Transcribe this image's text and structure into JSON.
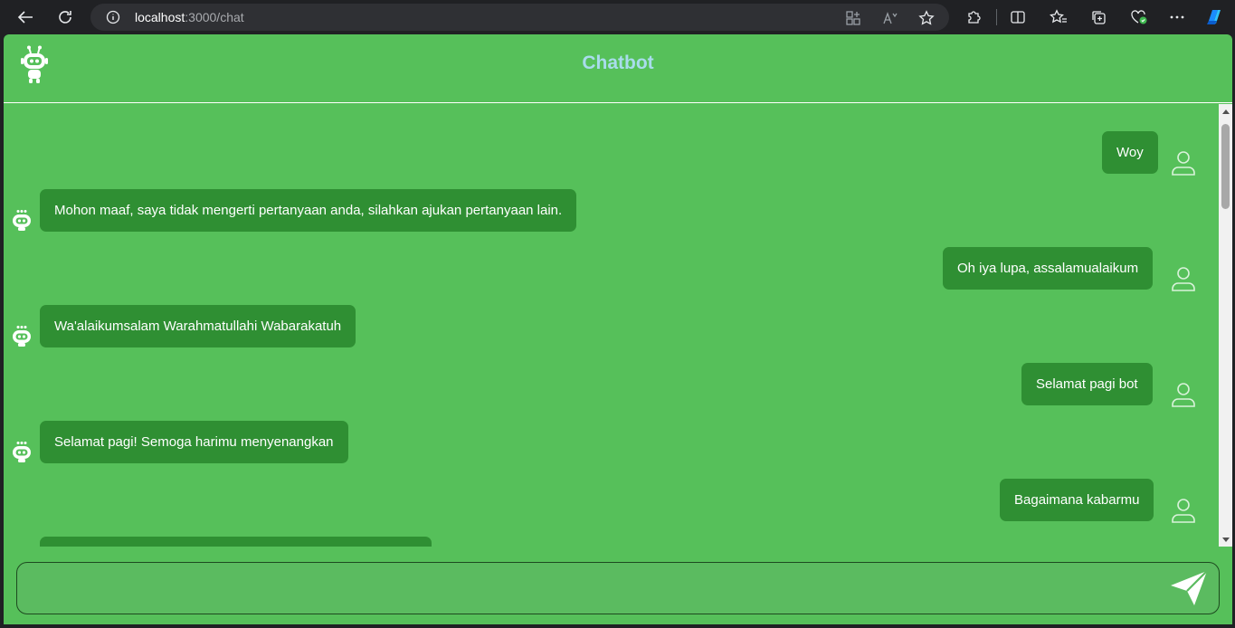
{
  "browser": {
    "url_host": "localhost",
    "url_path": ":3000/chat"
  },
  "app": {
    "title": "Chatbot"
  },
  "messages": [
    {
      "sender": "user",
      "text": "Woy"
    },
    {
      "sender": "bot",
      "text": "Mohon maaf, saya tidak mengerti pertanyaan anda, silahkan ajukan pertanyaan lain."
    },
    {
      "sender": "user",
      "text": "Oh iya lupa, assalamualaikum"
    },
    {
      "sender": "bot",
      "text": "Wa'alaikumsalam Warahmatullahi Wabarakatuh"
    },
    {
      "sender": "user",
      "text": "Selamat pagi bot"
    },
    {
      "sender": "bot",
      "text": "Selamat pagi! Semoga harimu menyenangkan"
    },
    {
      "sender": "user",
      "text": "Bagaimana kabarmu"
    },
    {
      "sender": "bot",
      "text": ""
    }
  ],
  "input": {
    "value": "",
    "placeholder": ""
  },
  "icons": {
    "logo": "robot-icon",
    "user_avatar": "user-icon",
    "bot_avatar": "robot-icon",
    "send": "send-icon"
  },
  "colors": {
    "background": "#56c05a",
    "bubble": "#2f8f33",
    "title": "#a9dcec"
  }
}
